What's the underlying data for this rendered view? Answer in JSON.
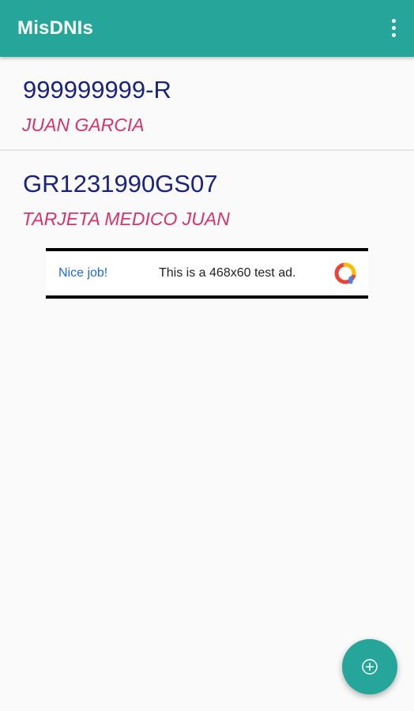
{
  "appbar": {
    "title": "MisDNIs",
    "menu_icon": "more-vert-icon",
    "color": "#26a69a"
  },
  "documents": [
    {
      "number": "999999999-R",
      "name": "JUAN GARCIA"
    },
    {
      "number": "GR1231990GS07",
      "name": "TARJETA MEDICO JUAN"
    }
  ],
  "ad": {
    "left_text": "Nice job!",
    "right_text": "This is a 468x60 test ad.",
    "logo_icon": "ad-logo-icon"
  },
  "fab": {
    "icon": "add-circle-icon"
  },
  "colors": {
    "number": "#1a237e",
    "name": "#d6336c",
    "background": "#fafafa"
  }
}
